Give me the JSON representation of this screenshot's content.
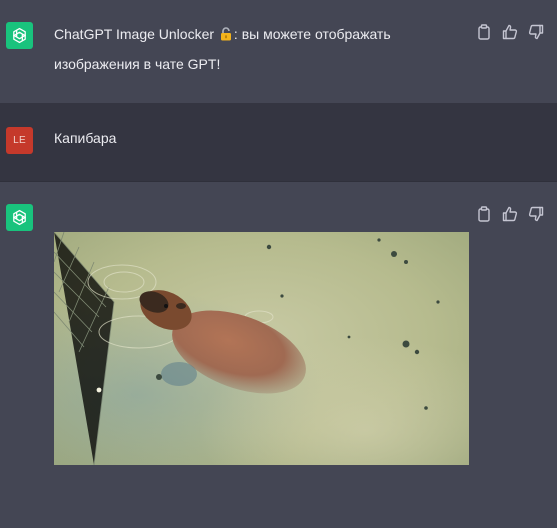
{
  "messages": [
    {
      "role": "assistant",
      "prefix": "ChatGPT Image Unlocker",
      "icon": "lock-icon",
      "suffix": ": вы можете отображать",
      "line2": "изображения в чате GPT!"
    },
    {
      "role": "user",
      "avatar_initials": "LE",
      "text": "Капибара"
    },
    {
      "role": "assistant",
      "image": "capybara-swimming-photo"
    }
  ],
  "action_icons": [
    "clipboard-icon",
    "thumbs-up-icon",
    "thumbs-down-icon"
  ],
  "colors": {
    "assistant_bg": "#444654",
    "user_bg": "#343541",
    "gpt_avatar": "#19c37d",
    "user_avatar": "#c5392b",
    "text": "#ececf1"
  }
}
